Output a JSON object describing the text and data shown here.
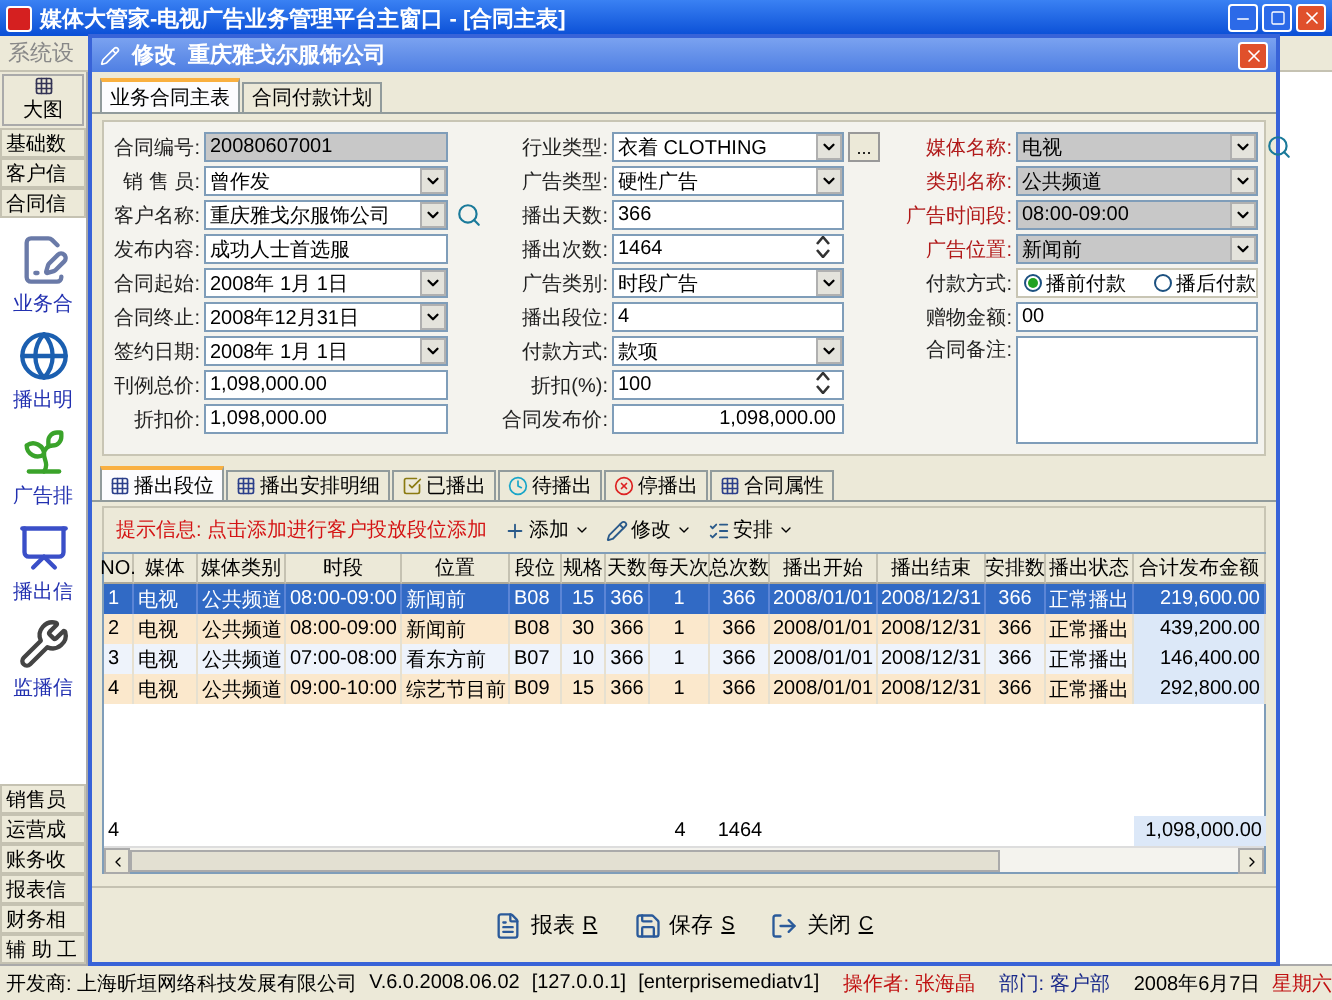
{
  "window": {
    "title": "媒体大管家-电视广告业务管理平台主窗口 - [合同主表]"
  },
  "menu": {
    "label": "系统设"
  },
  "toolbar": {
    "button": "大图"
  },
  "sidebar": {
    "top_items": [
      {
        "label": "基础数"
      },
      {
        "label": "客户信"
      },
      {
        "label": "合同信"
      }
    ],
    "icons": [
      {
        "label": "业务合",
        "kind": "contract"
      },
      {
        "label": "播出明",
        "kind": "globe"
      },
      {
        "label": "广告排",
        "kind": "plant"
      },
      {
        "label": "播出信",
        "kind": "chart"
      },
      {
        "label": "监播信",
        "kind": "tools"
      }
    ],
    "bottom_items": [
      {
        "label": "销售员"
      },
      {
        "label": "运营成"
      },
      {
        "label": "账务收"
      },
      {
        "label": "报表信"
      },
      {
        "label": "财务相"
      },
      {
        "label": "辅 助 工"
      }
    ]
  },
  "dialog": {
    "title": "修改",
    "subtitle": "重庆雅戈尔服饰公司",
    "tabs": [
      {
        "label": "业务合同主表",
        "selected": true
      },
      {
        "label": "合同付款计划",
        "selected": false
      }
    ],
    "form": {
      "columns": [
        [
          {
            "label": "合同编号:",
            "value": "20080607001",
            "kind": "text",
            "readonly": true
          },
          {
            "label": "销 售 员:",
            "value": "曾作发",
            "kind": "select"
          },
          {
            "label": "客户名称:",
            "value": "重庆雅戈尔服饰公司",
            "kind": "select",
            "lookup": true
          },
          {
            "label": "发布内容:",
            "value": "成功人士首选服",
            "kind": "text"
          },
          {
            "label": "合同起始:",
            "value": "2008年 1月 1日",
            "kind": "select"
          },
          {
            "label": "合同终止:",
            "value": "2008年12月31日",
            "kind": "select"
          },
          {
            "label": "签约日期:",
            "value": "2008年 1月 1日",
            "kind": "select"
          },
          {
            "label": "刊例总价:",
            "value": "1,098,000.00",
            "kind": "text"
          },
          {
            "label": "折扣价:",
            "value": "1,098,000.00",
            "kind": "text"
          }
        ],
        [
          {
            "label": "行业类型:",
            "value": "衣着 CLOTHING",
            "kind": "select",
            "button": "..."
          },
          {
            "label": "广告类型:",
            "value": "硬性广告",
            "kind": "select"
          },
          {
            "label": "播出天数:",
            "value": "366",
            "kind": "text"
          },
          {
            "label": "播出次数:",
            "value": "1464",
            "kind": "spin"
          },
          {
            "label": "广告类别:",
            "value": "时段广告",
            "kind": "select"
          },
          {
            "label": "播出段位:",
            "value": "4",
            "kind": "text"
          },
          {
            "label": "付款方式:",
            "value": "款项",
            "kind": "select"
          },
          {
            "label": "折扣(%):",
            "value": "100",
            "kind": "spin"
          },
          {
            "label": "合同发布价:",
            "value": "1,098,000.00",
            "kind": "number"
          }
        ],
        [
          {
            "label": "媒体名称:",
            "value": "电视",
            "kind": "select",
            "readonly": true,
            "required": true,
            "lookup": true
          },
          {
            "label": "类别名称:",
            "value": "公共频道",
            "kind": "select",
            "readonly": true,
            "required": true
          },
          {
            "label": "广告时间段:",
            "value": "08:00-09:00",
            "kind": "select",
            "readonly": true,
            "required": true
          },
          {
            "label": "广告位置:",
            "value": "新闻前",
            "kind": "select",
            "readonly": true,
            "required": true
          },
          {
            "label": "付款方式:",
            "kind": "radio",
            "options": [
              {
                "label": "播前付款",
                "selected": true
              },
              {
                "label": "播后付款",
                "selected": false
              }
            ]
          },
          {
            "label": "赠物金额:",
            "value": "00",
            "kind": "text"
          },
          {
            "label": "合同备注:",
            "kind": "memo"
          }
        ]
      ]
    },
    "lower_tabs": [
      {
        "label": "播出段位",
        "selected": true,
        "kind": "grid"
      },
      {
        "label": "播出安排明细",
        "selected": false,
        "kind": "grid"
      },
      {
        "label": "已播出",
        "selected": false,
        "kind": "done"
      },
      {
        "label": "待播出",
        "selected": false,
        "kind": "wait"
      },
      {
        "label": "停播出",
        "selected": false,
        "kind": "stop"
      },
      {
        "label": "合同属性",
        "selected": false,
        "kind": "grid"
      }
    ],
    "hint": "提示信息: 点击添加进行客户投放段位添加",
    "actions": [
      {
        "label": "添加",
        "kind": "add"
      },
      {
        "label": "修改",
        "kind": "edit"
      },
      {
        "label": "安排",
        "kind": "arrange"
      }
    ],
    "table": {
      "columns": [
        "NO.",
        "媒体",
        "媒体类别",
        "时段",
        "位置",
        "段位",
        "规格",
        "天数",
        "每天次",
        "总次数",
        "播出开始",
        "播出结束",
        "安排数",
        "播出状态",
        "合计发布金额"
      ],
      "rows": [
        {
          "selected": true,
          "cells": [
            "1",
            "电视",
            "公共频道",
            "08:00-09:00",
            "新闻前",
            "B08",
            "15",
            "366",
            "1",
            "366",
            "2008/01/01",
            "2008/12/31",
            "366",
            "正常播出",
            "219,600.00"
          ]
        },
        {
          "selected": false,
          "cells": [
            "2",
            "电视",
            "公共频道",
            "08:00-09:00",
            "新闻前",
            "B08",
            "30",
            "366",
            "1",
            "366",
            "2008/01/01",
            "2008/12/31",
            "366",
            "正常播出",
            "439,200.00"
          ]
        },
        {
          "selected": false,
          "cells": [
            "3",
            "电视",
            "公共频道",
            "07:00-08:00",
            "看东方前",
            "B07",
            "10",
            "366",
            "1",
            "366",
            "2008/01/01",
            "2008/12/31",
            "366",
            "正常播出",
            "146,400.00"
          ]
        },
        {
          "selected": false,
          "cells": [
            "4",
            "电视",
            "公共频道",
            "09:00-10:00",
            "综艺节目前",
            "B09",
            "15",
            "366",
            "1",
            "366",
            "2008/01/01",
            "2008/12/31",
            "366",
            "正常播出",
            "292,800.00"
          ]
        }
      ],
      "footer": {
        "no": "4",
        "per_day": "4",
        "total": "1464",
        "amount": "1,098,000.00"
      }
    },
    "buttons": [
      {
        "label": "报表",
        "key": "R",
        "kind": "report"
      },
      {
        "label": "保存",
        "key": "S",
        "kind": "save"
      },
      {
        "label": "关闭",
        "key": "C",
        "kind": "close"
      }
    ]
  },
  "status_bar": {
    "developer": "开发商: 上海昕垣网络科技发展有限公司",
    "version": "V.6.0.2008.06.02",
    "ip": "[127.0.0.1]",
    "database": "[enterprisemediatv1]",
    "operator": "操作者: 张海晶",
    "department": "部门: 客户部",
    "date": "2008年6月7日",
    "weekday": "星期六"
  }
}
